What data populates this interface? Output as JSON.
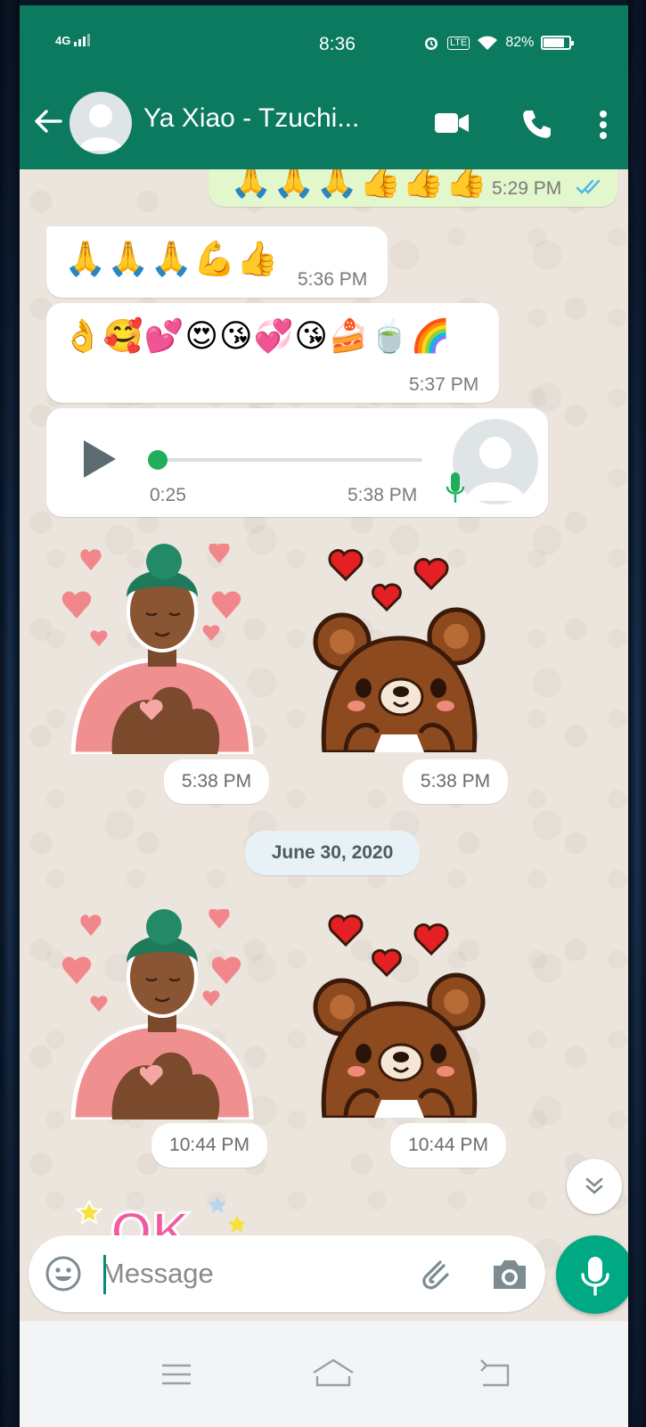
{
  "status_bar": {
    "network": "4G",
    "time": "8:36",
    "volte": "LTE",
    "battery": "82%",
    "battery_level": 0.82
  },
  "header": {
    "contact_name": "Ya Xiao - Tzuchi...",
    "icons": [
      "back-arrow-icon",
      "avatar-icon",
      "video-call-icon",
      "phone-call-icon",
      "more-vertical-icon"
    ]
  },
  "messages": [
    {
      "type": "text",
      "direction": "outgoing",
      "content": "🙏🙏🙏👍👍👍",
      "time": "5:29 PM",
      "status": "read"
    },
    {
      "type": "text",
      "direction": "incoming",
      "content": "🙏🙏🙏💪👍",
      "time": "5:36 PM"
    },
    {
      "type": "text",
      "direction": "incoming",
      "content": "👌🥰💕😍😘💞😘🍰🍵🌈",
      "time": "5:37 PM"
    },
    {
      "type": "voice",
      "direction": "incoming",
      "duration": "0:25",
      "progress": 0.0,
      "time": "5:38 PM"
    },
    {
      "type": "sticker",
      "direction": "incoming",
      "sticker": "woman-heart-hands",
      "time": "5:38 PM"
    },
    {
      "type": "sticker",
      "direction": "incoming",
      "sticker": "bear-hearts",
      "time": "5:38 PM"
    },
    {
      "type": "sticker",
      "direction": "incoming",
      "sticker": "woman-heart-hands",
      "time": "10:44 PM"
    },
    {
      "type": "sticker",
      "direction": "incoming",
      "sticker": "bear-hearts",
      "time": "10:44 PM"
    },
    {
      "type": "sticker",
      "direction": "incoming",
      "sticker": "ok-stars",
      "text": "OK"
    }
  ],
  "date_divider": "June 30, 2020",
  "composer": {
    "placeholder": "Message",
    "value": ""
  },
  "colors": {
    "header": "#0b7a5f",
    "chat_bg": "#ece5dd",
    "outgoing_bubble": "#e2f7cb",
    "read_ticks": "#4fb6ec",
    "mic_button": "#00a884"
  }
}
